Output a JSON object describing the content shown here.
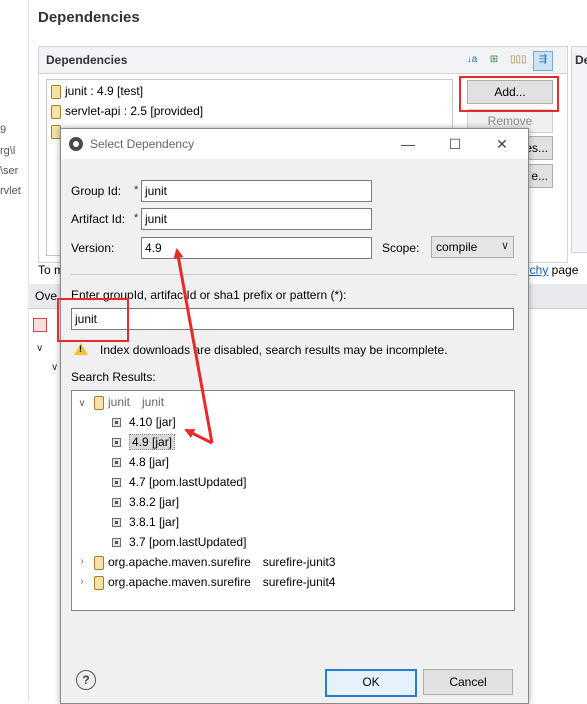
{
  "background": {
    "left_strip_fragments": [
      "9",
      "rg\\l",
      "\\ser",
      "rvlet"
    ],
    "page_title": "Dependencies",
    "dependencies_section": {
      "header": "Dependencies",
      "items": [
        "junit : 4.9 [test]",
        "servlet-api : 2.5 [provided]"
      ],
      "buttons": [
        "Add...",
        "Remove",
        "es...",
        "e..."
      ]
    },
    "right_header_fragment": "De",
    "below_text_left": "To m",
    "below_link": "archy",
    "below_text_right": " page",
    "tab_fragment": "Ove"
  },
  "dialog": {
    "title": "Select Dependency",
    "group_id_label": "Group Id:",
    "group_id_value": "junit",
    "artifact_id_label": "Artifact Id:",
    "artifact_id_value": "junit",
    "version_label": "Version:",
    "version_value": "4.9",
    "scope_label": "Scope:",
    "scope_value": "compile",
    "required_marker": "*",
    "search_label": "Enter groupId, artifactId or sha1 prefix or pattern (*):",
    "search_value": "junit",
    "warning": "Index downloads are disabled, search results may be incomplete.",
    "results_label": "Search Results:",
    "results": {
      "group": "junit",
      "artifact": "junit",
      "versions": [
        "4.10 [jar]",
        "4.9 [jar]",
        "4.8 [jar]",
        "4.7 [pom.lastUpdated]",
        "3.8.2 [jar]",
        "3.8.1 [jar]",
        "3.7 [pom.lastUpdated]"
      ],
      "others": [
        {
          "group": "org.apache.maven.surefire",
          "artifact": "surefire-junit3"
        },
        {
          "group": "org.apache.maven.surefire",
          "artifact": "surefire-junit4"
        }
      ]
    },
    "ok_label": "OK",
    "cancel_label": "Cancel"
  },
  "colors": {
    "annotation_red": "#e52b2b",
    "default_button_border": "#2a7ad5"
  },
  "icons": [
    "jar-icon",
    "sort-az-icon",
    "hierarchy-icon",
    "show-group-icon",
    "filter-icon",
    "dialog-app-icon",
    "minimize-icon",
    "maximize-icon",
    "close-icon",
    "warning-icon",
    "chevron-down-icon",
    "chevron-right-icon",
    "version-icon",
    "help-icon"
  ]
}
